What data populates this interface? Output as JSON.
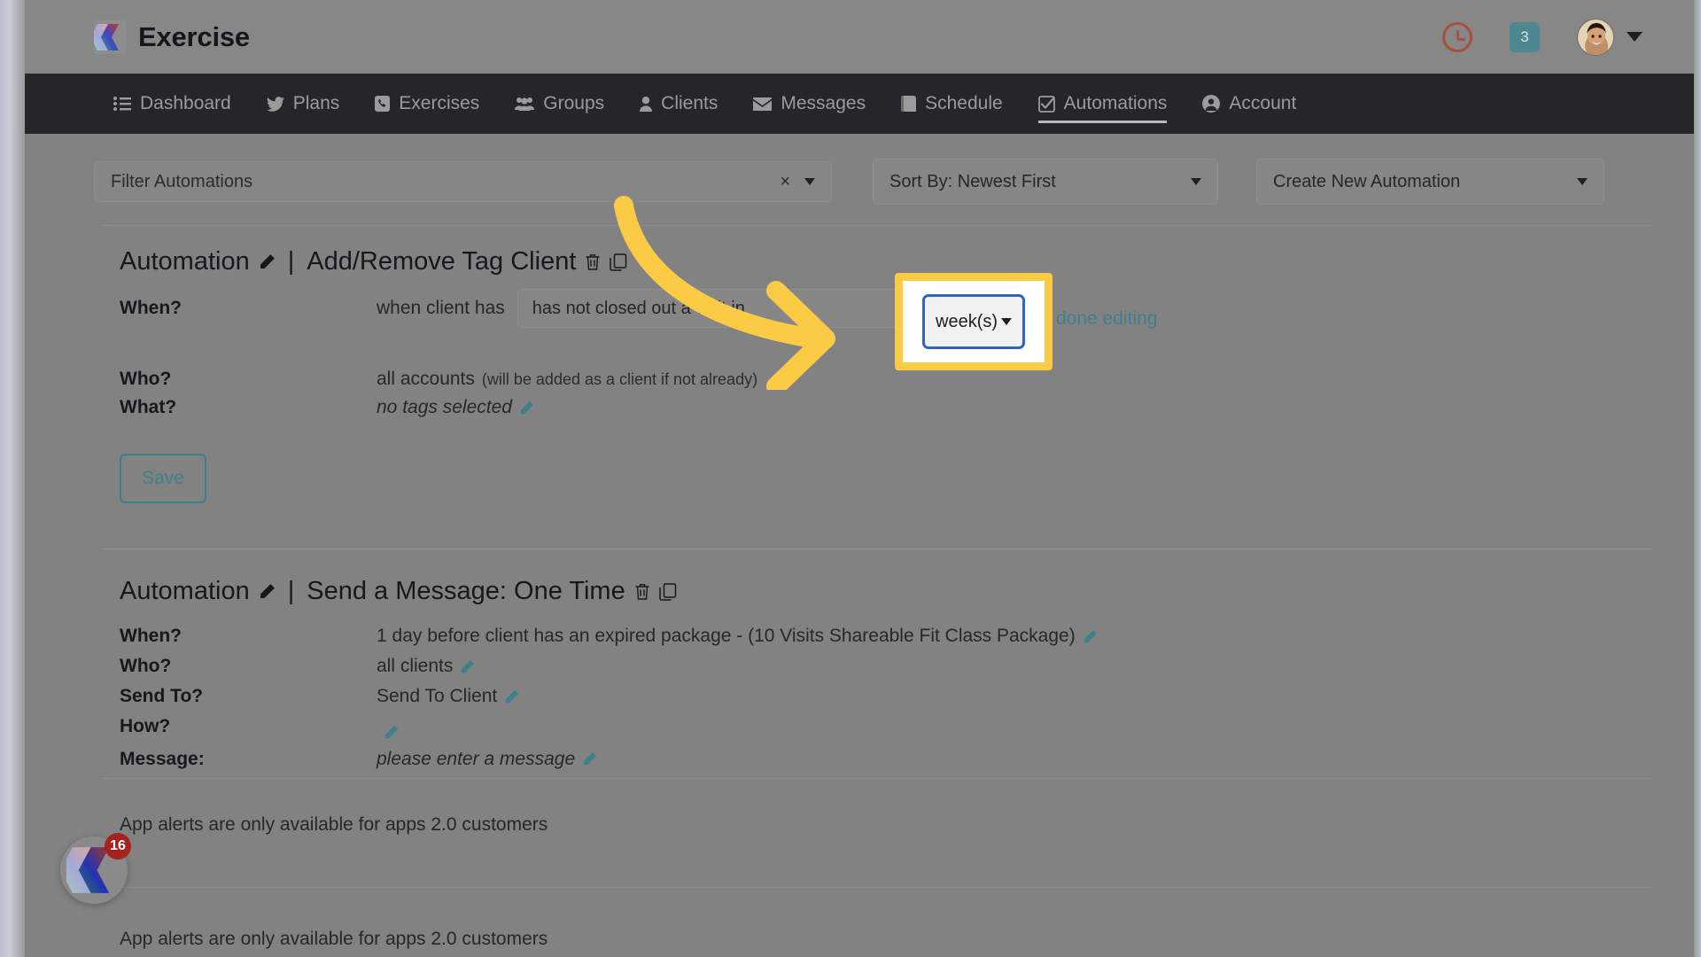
{
  "brand": {
    "name": "Exercise",
    "logo_icon": "exercise-logo-icon"
  },
  "header": {
    "clock_icon": "clock-icon",
    "notification_count": "3",
    "avatar_icon": "user-avatar",
    "chevron_icon": "chevron-down-icon",
    "clock_color": "#a9503c",
    "badge_color": "#4d8792"
  },
  "nav": {
    "items": [
      {
        "label": "Dashboard",
        "icon": "list-icon",
        "active": false
      },
      {
        "label": "Plans",
        "icon": "bird-icon",
        "active": false
      },
      {
        "label": "Exercises",
        "icon": "phone-icon",
        "active": false
      },
      {
        "label": "Groups",
        "icon": "users-icon",
        "active": false
      },
      {
        "label": "Clients",
        "icon": "person-icon",
        "active": false
      },
      {
        "label": "Messages",
        "icon": "envelope-icon",
        "active": false
      },
      {
        "label": "Schedule",
        "icon": "book-icon",
        "active": false
      },
      {
        "label": "Automations",
        "icon": "check-box-icon",
        "active": true
      },
      {
        "label": "Account",
        "icon": "account-icon",
        "active": false
      }
    ]
  },
  "toolbar": {
    "filter_placeholder": "Filter Automations",
    "filter_value": "",
    "clear_label": "×",
    "sort_value": "Sort By: Newest First",
    "create_value": "Create New Automation"
  },
  "automations": [
    {
      "prefix": "Automation",
      "separator": "|",
      "title": "Add/Remove Tag Client",
      "edit_icon": "pencil-icon",
      "delete_icon": "trash-icon",
      "copy_icon": "duplicate-icon",
      "when_label": "When?",
      "when_prefix": "when client has",
      "trigger_value": "has not closed out a visit in",
      "amount_value": "",
      "unit_value": "week(s)",
      "done_editing": "done editing",
      "who_label": "Who?",
      "who_value": "all accounts",
      "who_note": "(will be added as a client if not already)",
      "what_label": "What?",
      "what_value": "no tags selected",
      "save_label": "Save"
    },
    {
      "prefix": "Automation",
      "separator": "|",
      "title": "Send a Message: One Time",
      "edit_icon": "pencil-icon",
      "delete_icon": "trash-icon",
      "copy_icon": "duplicate-icon",
      "rows": [
        {
          "label": "When?",
          "value": "1 day before client has an expired package - (10 Visits Shareable Fit Class Package)",
          "italic": false
        },
        {
          "label": "Who?",
          "value": "all clients",
          "italic": false
        },
        {
          "label": "Send To?",
          "value": "Send To Client",
          "italic": false
        },
        {
          "label": "How?",
          "value": "",
          "italic": false
        },
        {
          "label": "Message:",
          "value": "please enter a message",
          "italic": true
        }
      ]
    }
  ],
  "alerts": [
    {
      "text": "App alerts are only available for apps 2.0 customers"
    },
    {
      "text": "App alerts are only available for apps 2.0 customers"
    }
  ],
  "fab": {
    "badge_count": "16",
    "icon": "exercise-logo-icon"
  },
  "annotation": {
    "arrow_color": "#fbcb46",
    "highlight_color": "#fbcb46",
    "focus_border_color": "#2f63c8",
    "highlighted_control": "week(s)",
    "highlighted_control_caret": "chevron-down-icon"
  }
}
